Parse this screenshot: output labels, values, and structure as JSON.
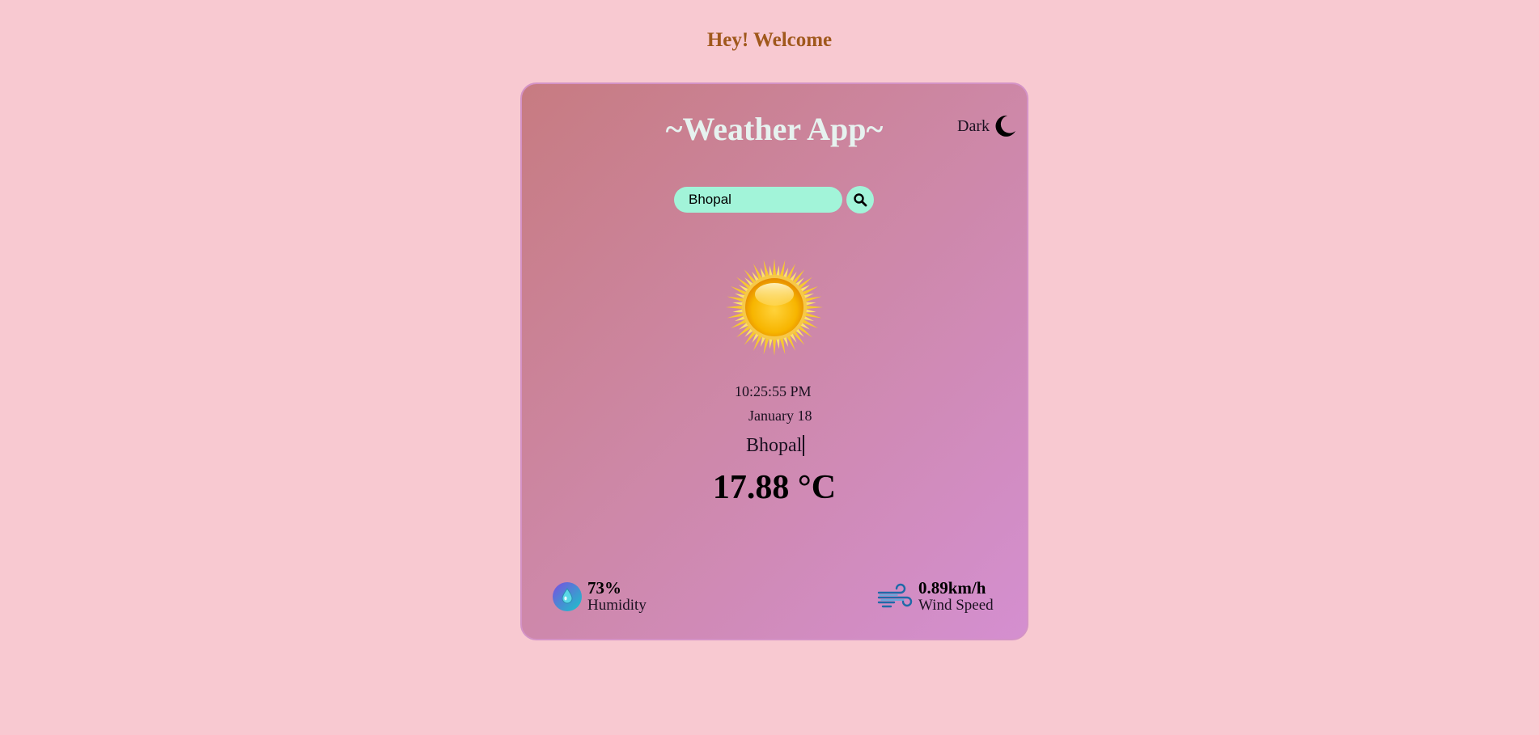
{
  "header": {
    "welcome": "Hey! Welcome"
  },
  "app": {
    "title": "~Weather App~",
    "theme_toggle_label": "Dark",
    "theme_toggle_icon": "moon-icon"
  },
  "search": {
    "value": "Bhopal",
    "button_icon": "search-icon"
  },
  "weather": {
    "icon": "sun-icon",
    "time": "10:25:55 PM",
    "date": "January 18",
    "city": "Bhopal",
    "temperature": "17.88 °C"
  },
  "stats": {
    "humidity": {
      "icon": "humidity-drop-icon",
      "value": "73%",
      "label": "Humidity"
    },
    "wind": {
      "icon": "wind-icon",
      "value": "0.89km/h",
      "label": "Wind Speed"
    }
  },
  "colors": {
    "page_background": "#f8c9d1",
    "welcome_text": "#a0581c",
    "card_gradient_start": "#c77b81",
    "card_gradient_end": "#d48fd0",
    "title_text": "#e6f2ef",
    "search_background": "#a2f4d9"
  }
}
